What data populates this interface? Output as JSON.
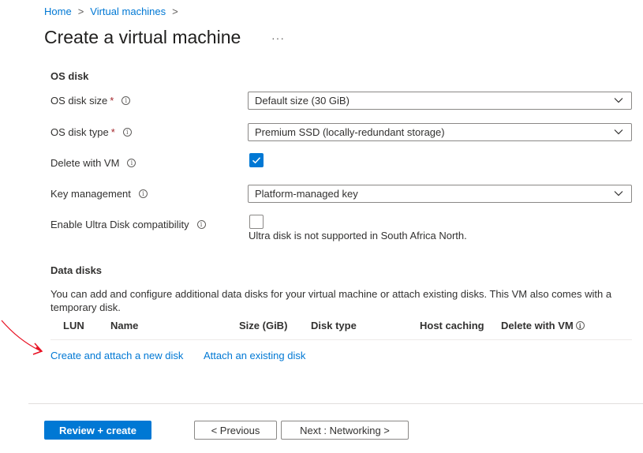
{
  "breadcrumb": {
    "home": "Home",
    "separator": ">",
    "virtual_machines": "Virtual machines"
  },
  "page": {
    "title": "Create a virtual machine",
    "more": "···"
  },
  "os_disk": {
    "section_title": "OS disk",
    "size_label": "OS disk size",
    "size_value": "Default size (30 GiB)",
    "type_label": "OS disk type",
    "type_value": "Premium SSD (locally-redundant storage)",
    "delete_label": "Delete with VM",
    "delete_checked": true,
    "key_label": "Key management",
    "key_value": "Platform-managed key",
    "ultra_label": "Enable Ultra Disk compatibility",
    "ultra_checked": false,
    "ultra_note": "Ultra disk is not supported in South Africa North."
  },
  "required_mark": "*",
  "info_glyph": "i",
  "data_disks": {
    "section_title": "Data disks",
    "description": "You can add and configure additional data disks for your virtual machine or attach existing disks. This VM also comes with a temporary disk.",
    "columns": {
      "lun": "LUN",
      "name": "Name",
      "size": "Size (GiB)",
      "disk_type": "Disk type",
      "host_caching": "Host caching",
      "delete_with_vm": "Delete with VM"
    },
    "create_link": "Create and attach a new disk",
    "attach_link": "Attach an existing disk"
  },
  "footer": {
    "review_create": "Review + create",
    "previous": "< Previous",
    "next": "Next : Networking >"
  },
  "colors": {
    "accent": "#0078d4",
    "annotation": "#e81123"
  }
}
